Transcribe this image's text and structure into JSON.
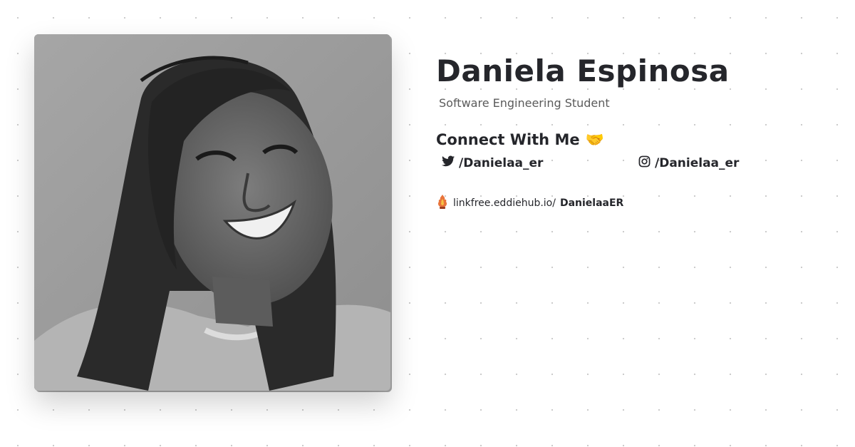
{
  "profile": {
    "name": "Daniela Espinosa",
    "subtitle": "Software Engineering Student",
    "photo_alt": "Portrait of Daniela Espinosa"
  },
  "connect": {
    "heading": "Connect With Me",
    "emoji": "🤝"
  },
  "socials": [
    {
      "network": "twitter",
      "icon": "twitter-icon",
      "handle": "/Danielaa_er"
    },
    {
      "network": "instagram",
      "icon": "instagram-icon",
      "handle": "/Danielaa_er"
    }
  ],
  "linkfree": {
    "icon": "linkfree-icon",
    "domain": "linkfree.eddiehub.io/",
    "username": "DanielaaER"
  },
  "colors": {
    "text": "#25262b",
    "muted": "#5b5b5b",
    "dots": "#c9c9c9",
    "background": "#ffffff"
  }
}
